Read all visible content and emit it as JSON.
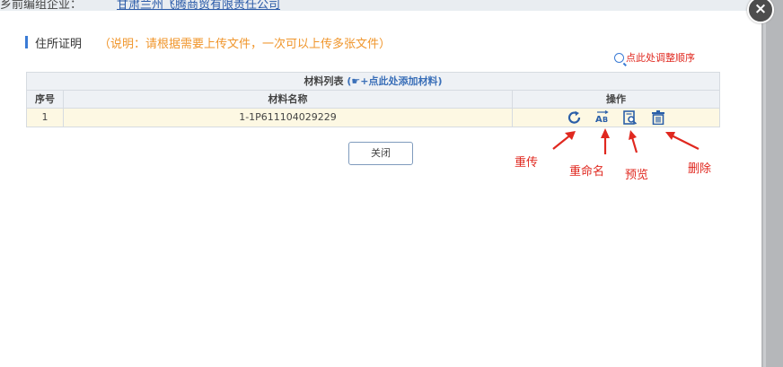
{
  "background": {
    "label": "乡前编组企业：",
    "company": "甘肃兰州飞腾商贸有限责任公司"
  },
  "modal": {
    "close_icon": "×",
    "title": "住所证明",
    "note": "（说明：请根据需要上传文件，一次可以上传多张文件）",
    "reorder_link": "点此处调整顺序",
    "table": {
      "caption": "材料列表",
      "add_link": "+点此处添加材料",
      "headers": [
        "序号",
        "材料名称",
        "操作"
      ],
      "rows": [
        {
          "index": "1",
          "name": "1-1P611104029229"
        }
      ]
    },
    "close_button": "关闭"
  },
  "annotations": {
    "reupload": "重传",
    "rename": "重命名",
    "preview": "预览",
    "delete": "删除"
  },
  "icons": [
    "reupload-icon",
    "rename-icon",
    "preview-icon",
    "delete-icon"
  ],
  "colors": {
    "accent_blue": "#3a7bd5",
    "note_orange": "#f0952a",
    "annotation_red": "#e0281f",
    "row_highlight": "#fdf8e3"
  }
}
